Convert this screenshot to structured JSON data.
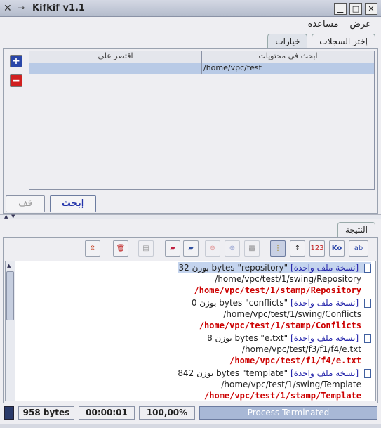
{
  "window": {
    "title": "Kifkif v1.1"
  },
  "menu": {
    "items": [
      "عرض",
      "مساعدة"
    ]
  },
  "tabs": {
    "items": [
      "إختر السجلات",
      "خيارات"
    ],
    "active": 0
  },
  "search_table": {
    "headers": [
      "ابحث في محتويات",
      "اقتصر على"
    ],
    "rows": [
      [
        "/home/vpc/test",
        ""
      ]
    ]
  },
  "actions": {
    "search_label": "إبحث",
    "stop_label": "قف"
  },
  "result_tab": {
    "label": "النتيجة"
  },
  "results": {
    "groups": [
      {
        "kind": "[نسخة ملف واحدة]",
        "name": "\"repository\"",
        "size_text": "بوزن 32 bytes",
        "paths": [
          "/home/vpc/test/1/swing/Repository"
        ],
        "dup_path": "/home/vpc/test/1/stamp/Repository"
      },
      {
        "kind": "[نسخة ملف واحدة]",
        "name": "\"conflicts\"",
        "size_text": "بوزن 0 bytes",
        "paths": [
          "/home/vpc/test/1/swing/Conflicts"
        ],
        "dup_path": "/home/vpc/test/1/stamp/Conflicts"
      },
      {
        "kind": "[نسخة ملف واحدة]",
        "name": "\"e.txt\"",
        "size_text": "بوزن 8 bytes",
        "paths": [
          "/home/vpc/test/f3/f1/f4/e.txt"
        ],
        "dup_path": "/home/vpc/test/f1/f4/e.txt"
      },
      {
        "kind": "[نسخة ملف واحدة]",
        "name": "\"template\"",
        "size_text": "بوزن 842 bytes",
        "paths": [
          "/home/vpc/test/1/swing/Template"
        ],
        "dup_path": "/home/vpc/test/1/stamp/Template"
      }
    ]
  },
  "status": {
    "size": "958 bytes",
    "time": "00:00:01",
    "percent": "100,00%",
    "progress_text": "Process Terminated",
    "progress_value": 1.0
  },
  "colors": {
    "accent": "#a8b8d6",
    "duplicate": "#cc0000",
    "link": "#2222aa"
  }
}
